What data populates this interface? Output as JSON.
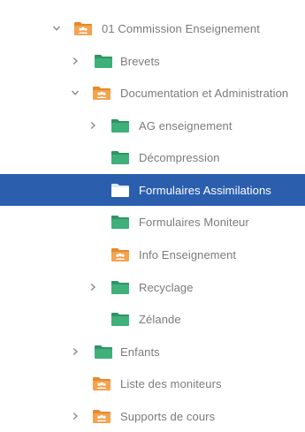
{
  "colors": {
    "folder_green": "#3fb07a",
    "folder_green_tab": "#2f9566",
    "shared_orange": "#f5a34f",
    "shared_orange_tab": "#e58a2e",
    "selected_bg": "#2b5fae",
    "text": "#7b7b7b"
  },
  "tree": {
    "items": [
      {
        "label": "01 Commission Enseignement",
        "icon": "shared-folder-icon",
        "chevron": "down"
      },
      {
        "label": "Brevets",
        "icon": "folder-icon",
        "chevron": "right"
      },
      {
        "label": "Documentation et Administration",
        "icon": "shared-folder-icon",
        "chevron": "down"
      },
      {
        "label": "AG enseignement",
        "icon": "folder-icon",
        "chevron": "right"
      },
      {
        "label": "Décompression",
        "icon": "folder-icon",
        "chevron": "none"
      },
      {
        "label": "Formulaires Assimilations",
        "icon": "folder-icon",
        "chevron": "none",
        "selected": true
      },
      {
        "label": "Formulaires Moniteur",
        "icon": "folder-icon",
        "chevron": "none"
      },
      {
        "label": "Info Enseignement",
        "icon": "shared-folder-icon",
        "chevron": "none"
      },
      {
        "label": "Recyclage",
        "icon": "folder-icon",
        "chevron": "right"
      },
      {
        "label": "Zélande",
        "icon": "folder-icon",
        "chevron": "none"
      },
      {
        "label": "Enfants",
        "icon": "folder-icon",
        "chevron": "right"
      },
      {
        "label": "Liste des moniteurs",
        "icon": "shared-folder-icon",
        "chevron": "none"
      },
      {
        "label": "Supports de cours",
        "icon": "shared-folder-icon",
        "chevron": "right"
      }
    ]
  }
}
